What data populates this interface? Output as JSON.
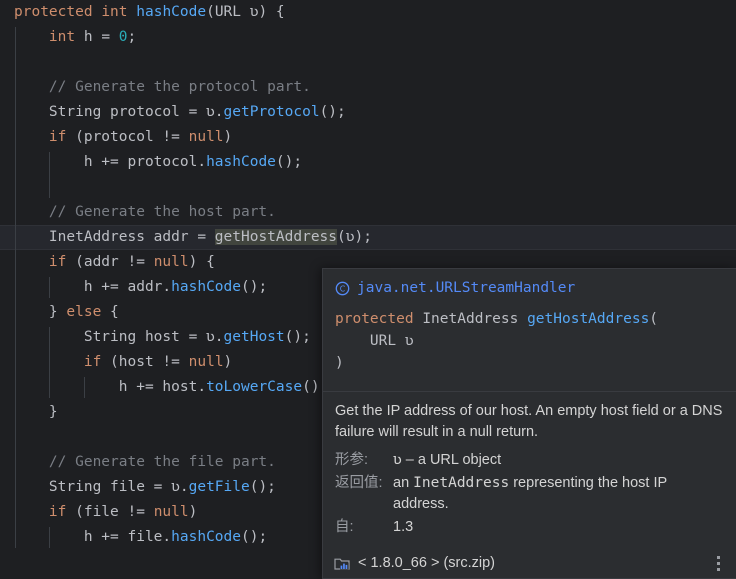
{
  "editor": {
    "language": "java",
    "background": "#1e1f22",
    "current_line_background": "#26282e",
    "highlight_token_background": "#41453e",
    "colors": {
      "keyword": "#cf8e6d",
      "number": "#2aacb8",
      "method": "#56a8f5",
      "comment": "#7a7e85",
      "identifier": "#bcbec4"
    },
    "lines": [
      {
        "indent": 0,
        "tokens": [
          {
            "t": "protected",
            "c": "kw"
          },
          {
            "t": " ",
            "c": "id"
          },
          {
            "t": "int",
            "c": "kw"
          },
          {
            "t": " ",
            "c": "id"
          },
          {
            "t": "hashCode",
            "c": "mth"
          },
          {
            "t": "(URL ʋ) {",
            "c": "id"
          }
        ]
      },
      {
        "indent": 1,
        "tokens": [
          {
            "t": "int",
            "c": "kw"
          },
          {
            "t": " h = ",
            "c": "id"
          },
          {
            "t": "0",
            "c": "num"
          },
          {
            "t": ";",
            "c": "id"
          }
        ]
      },
      {
        "indent": 1,
        "tokens": []
      },
      {
        "indent": 1,
        "tokens": [
          {
            "t": "// Generate the protocol part.",
            "c": "cmt"
          }
        ]
      },
      {
        "indent": 1,
        "tokens": [
          {
            "t": "String protocol = ʋ.",
            "c": "id"
          },
          {
            "t": "getProtocol",
            "c": "mth"
          },
          {
            "t": "();",
            "c": "id"
          }
        ]
      },
      {
        "indent": 1,
        "tokens": [
          {
            "t": "if",
            "c": "kw"
          },
          {
            "t": " (protocol != ",
            "c": "id"
          },
          {
            "t": "null",
            "c": "kw"
          },
          {
            "t": ")",
            "c": "id"
          }
        ]
      },
      {
        "indent": 2,
        "tokens": [
          {
            "t": "h += protocol.",
            "c": "id"
          },
          {
            "t": "hashCode",
            "c": "mth"
          },
          {
            "t": "();",
            "c": "id"
          }
        ]
      },
      {
        "indent": 1,
        "tokens": []
      },
      {
        "indent": 1,
        "tokens": [
          {
            "t": "// Generate the host part.",
            "c": "cmt"
          }
        ]
      },
      {
        "indent": 1,
        "current": true,
        "tokens": [
          {
            "t": "InetAddress addr = ",
            "c": "id"
          },
          {
            "t": "getHostAddress",
            "c": "id hl"
          },
          {
            "t": "(ʋ);",
            "c": "id"
          }
        ]
      },
      {
        "indent": 1,
        "tokens": [
          {
            "t": "if",
            "c": "kw"
          },
          {
            "t": " (addr != ",
            "c": "id"
          },
          {
            "t": "null",
            "c": "kw"
          },
          {
            "t": ") {",
            "c": "id"
          }
        ]
      },
      {
        "indent": 2,
        "tokens": [
          {
            "t": "h += addr.",
            "c": "id"
          },
          {
            "t": "hashCode",
            "c": "mth"
          },
          {
            "t": "();",
            "c": "id"
          }
        ]
      },
      {
        "indent": 1,
        "tokens": [
          {
            "t": "} ",
            "c": "id"
          },
          {
            "t": "else",
            "c": "kw"
          },
          {
            "t": " {",
            "c": "id"
          }
        ]
      },
      {
        "indent": 2,
        "tokens": [
          {
            "t": "String host = ʋ.",
            "c": "id"
          },
          {
            "t": "getHost",
            "c": "mth"
          },
          {
            "t": "();",
            "c": "id"
          }
        ]
      },
      {
        "indent": 2,
        "tokens": [
          {
            "t": "if",
            "c": "kw"
          },
          {
            "t": " (host != ",
            "c": "id"
          },
          {
            "t": "null",
            "c": "kw"
          },
          {
            "t": ")",
            "c": "id"
          }
        ]
      },
      {
        "indent": 3,
        "tokens": [
          {
            "t": "h += host.",
            "c": "id"
          },
          {
            "t": "toLowerCase",
            "c": "mth"
          },
          {
            "t": "().",
            "c": "id"
          }
        ]
      },
      {
        "indent": 1,
        "tokens": [
          {
            "t": "}",
            "c": "id"
          }
        ]
      },
      {
        "indent": 1,
        "tokens": []
      },
      {
        "indent": 1,
        "tokens": [
          {
            "t": "// Generate the file part.",
            "c": "cmt"
          }
        ]
      },
      {
        "indent": 1,
        "tokens": [
          {
            "t": "String file = ʋ.",
            "c": "id"
          },
          {
            "t": "getFile",
            "c": "mth"
          },
          {
            "t": "();",
            "c": "id"
          }
        ]
      },
      {
        "indent": 1,
        "tokens": [
          {
            "t": "if",
            "c": "kw"
          },
          {
            "t": " (file != ",
            "c": "id"
          },
          {
            "t": "null",
            "c": "kw"
          },
          {
            "t": ")",
            "c": "id"
          }
        ]
      },
      {
        "indent": 2,
        "tokens": [
          {
            "t": "h += file.",
            "c": "id"
          },
          {
            "t": "hashCode",
            "c": "mth"
          },
          {
            "t": "();",
            "c": "id"
          }
        ]
      }
    ]
  },
  "doc_popup": {
    "class_icon": "class-icon",
    "class_name": "java.net.URLStreamHandler",
    "signature_modifier": "protected",
    "signature_return_type": "InetAddress",
    "signature_method": "getHostAddress",
    "signature_open_paren": "(",
    "signature_param": "URL ʋ",
    "signature_close_paren": ")",
    "description": "Get the IP address of our host. An empty host field or a DNS failure will result in a null return.",
    "tags": [
      {
        "label": "形参:",
        "value_mono": "ʋ",
        "value_text": " – a URL object"
      },
      {
        "label": "返回值:",
        "value_prefix": "an ",
        "value_mono": "InetAddress",
        "value_text": " representing the host IP address."
      },
      {
        "label": "自:",
        "value_text": "1.3"
      }
    ],
    "footer": {
      "folder_icon": "library-folder-icon",
      "source": "< 1.8.0_66 > (src.zip)",
      "menu_icon": "kebab-menu-icon"
    },
    "colors": {
      "background": "#2b2d30",
      "border": "#393b40",
      "link": "#548af7",
      "label": "#9a9da3"
    }
  }
}
